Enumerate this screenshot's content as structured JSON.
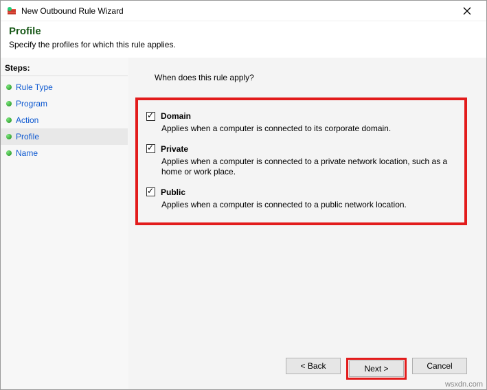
{
  "window": {
    "title": "New Outbound Rule Wizard"
  },
  "header": {
    "title": "Profile",
    "subtitle": "Specify the profiles for which this rule applies."
  },
  "sidebar": {
    "title": "Steps:",
    "items": [
      {
        "label": "Rule Type",
        "active": false
      },
      {
        "label": "Program",
        "active": false
      },
      {
        "label": "Action",
        "active": false
      },
      {
        "label": "Profile",
        "active": true
      },
      {
        "label": "Name",
        "active": false
      }
    ]
  },
  "main": {
    "prompt": "When does this rule apply?",
    "options": [
      {
        "key": "domain",
        "label": "Domain",
        "checked": true,
        "desc": "Applies when a computer is connected to its corporate domain."
      },
      {
        "key": "private",
        "label": "Private",
        "checked": true,
        "desc": "Applies when a computer is connected to a private network location, such as a home or work place."
      },
      {
        "key": "public",
        "label": "Public",
        "checked": true,
        "desc": "Applies when a computer is connected to a public network location."
      }
    ]
  },
  "footer": {
    "back": "< Back",
    "next": "Next >",
    "cancel": "Cancel"
  },
  "watermark": "wsxdn.com"
}
